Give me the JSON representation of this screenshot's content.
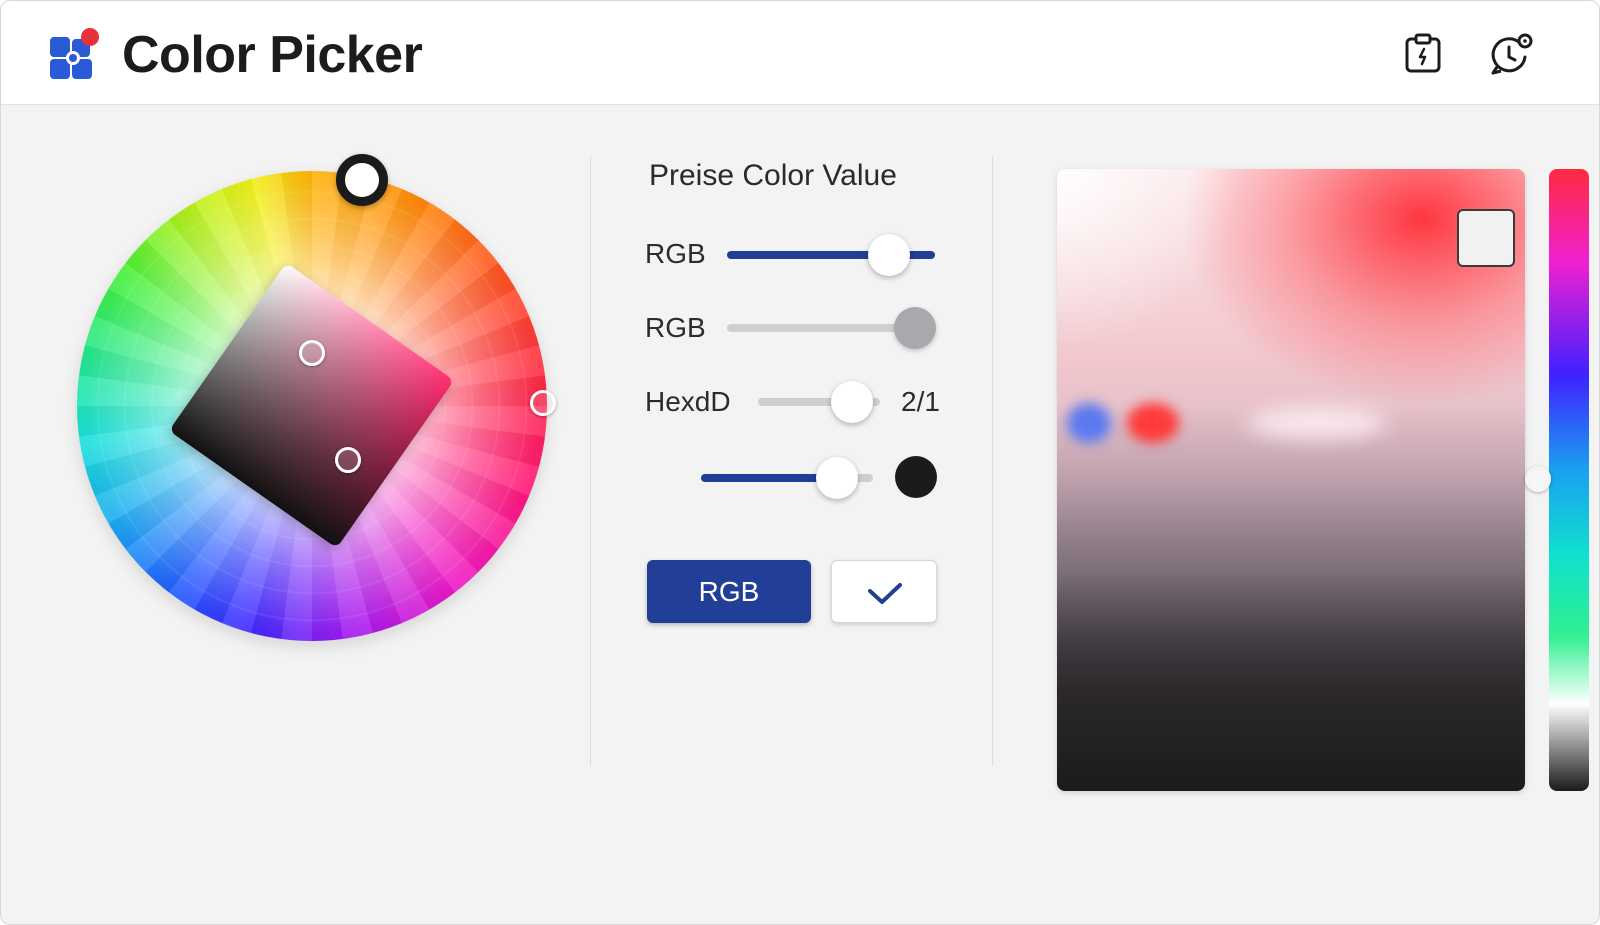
{
  "app": {
    "title": "Color Picker",
    "logo_icon": "app-logo-icon",
    "header_actions": [
      {
        "name": "clipboard-icon"
      },
      {
        "name": "history-icon"
      }
    ]
  },
  "wheel": {
    "icons": [
      "hue-handle",
      "saturation-handle",
      "brightness-handle"
    ]
  },
  "precise_panel": {
    "title": "Preise Color Value",
    "rows": [
      {
        "label": "RGB",
        "value_fraction": 0.78,
        "accent": "#223f98"
      },
      {
        "label": "RGB",
        "value_fraction": 1.0,
        "accent": "#cfcfd2"
      },
      {
        "label": "HexdD",
        "value_fraction": 0.77,
        "value_text": "2/1"
      },
      {
        "label": "",
        "value_fraction": 0.79,
        "swatch_color": "#1b1b1b"
      }
    ],
    "buttons": {
      "primary_label": "RGB",
      "confirm_icon": "checkmark-icon"
    }
  },
  "colors": {
    "accent": "#223f98",
    "window_bg": "#f3f3f3",
    "header_bg": "#ffffff"
  }
}
